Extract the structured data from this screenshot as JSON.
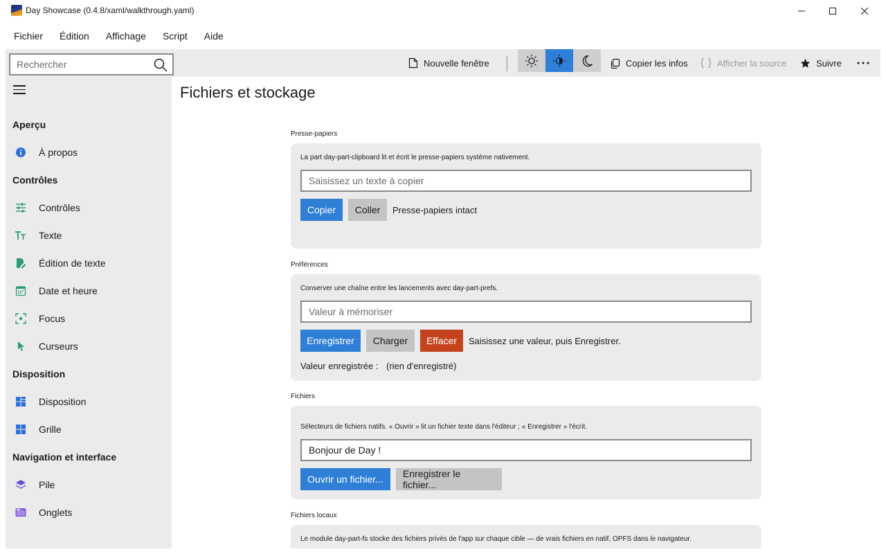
{
  "window": {
    "title": "Day Showcase (0.4.8/xaml/walkthrough.yaml)"
  },
  "menu": [
    "Fichier",
    "Édition",
    "Affichage",
    "Script",
    "Aide"
  ],
  "toolbar": {
    "search_placeholder": "Rechercher",
    "new_window": "Nouvelle fenêtre",
    "copy_info": "Copier les infos",
    "show_source": "Afficher la source",
    "follow": "Suivre",
    "accent_color": "#2f7fd6"
  },
  "sidebar": {
    "sections": [
      {
        "title": "Aperçu",
        "items": [
          {
            "label": "À propos",
            "icon": "info-icon"
          }
        ]
      },
      {
        "title": "Contrôles",
        "items": [
          {
            "label": "Contrôles",
            "icon": "sliders-icon"
          },
          {
            "label": "Texte",
            "icon": "text-icon"
          },
          {
            "label": "Édition de texte",
            "icon": "edit-document-icon"
          },
          {
            "label": "Date et heure",
            "icon": "calendar-icon"
          },
          {
            "label": "Focus",
            "icon": "focus-icon"
          },
          {
            "label": "Curseurs",
            "icon": "cursor-icon"
          }
        ]
      },
      {
        "title": "Disposition",
        "items": [
          {
            "label": "Disposition",
            "icon": "layout-icon"
          },
          {
            "label": "Grille",
            "icon": "grid-icon"
          }
        ]
      },
      {
        "title": "Navigation et interface",
        "items": [
          {
            "label": "Pile",
            "icon": "stack-icon"
          },
          {
            "label": "Onglets",
            "icon": "tabs-icon"
          }
        ]
      }
    ]
  },
  "main": {
    "title": "Fichiers et stockage",
    "clipboard": {
      "label": "Presse-papiers",
      "description": "La part day-part-clipboard lit et écrit le presse-papiers système nativement.",
      "input_placeholder": "Saisissez un texte à copier",
      "copy_button": "Copier",
      "paste_button": "Coller",
      "status": "Presse-papiers intact"
    },
    "prefs": {
      "label": "Préférences",
      "description": "Conserver une chaîne entre les lancements avec day-part-prefs.",
      "input_placeholder": "Valeur à mémoriser",
      "save_button": "Enregistrer",
      "load_button": "Charger",
      "clear_button": "Effacer",
      "status": "Saisissez une valeur, puis Enregistrer.",
      "saved_label": "Valeur enregistrée :",
      "saved_value": "(rien d'enregistré)"
    },
    "files": {
      "label": "Fichiers",
      "description": "Sélecteurs de fichiers natifs. « Ouvrir » lit un fichier texte dans l'éditeur ; « Enregistrer » l'écrit.",
      "input_value": "Bonjour de Day !",
      "open_button": "Ouvrir un fichier...",
      "save_button": "Enregistrer le fichier..."
    },
    "local_files": {
      "label": "Fichiers locaux",
      "description": "Le module day-part-fs stocke des fichiers privés de l'app sur chaque cible — de vrais fichiers en natif, OPFS dans le navigateur."
    }
  }
}
